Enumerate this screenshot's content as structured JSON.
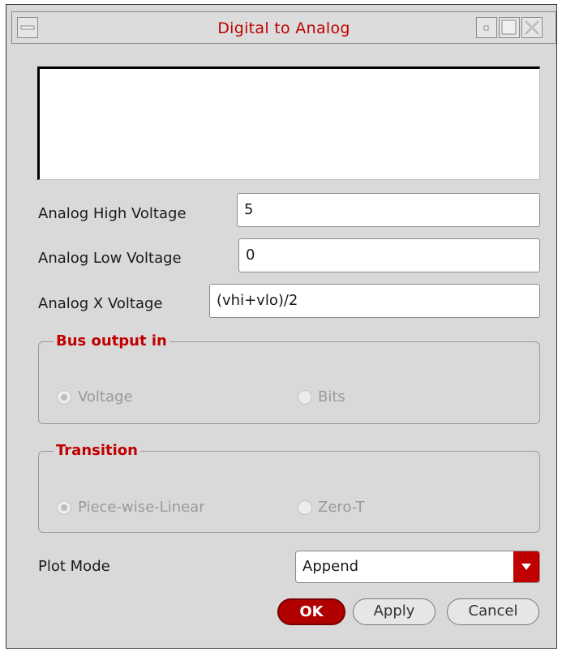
{
  "window": {
    "title": "Digital to Analog"
  },
  "fields": {
    "high": {
      "label": "Analog High Voltage",
      "value": "5"
    },
    "low": {
      "label": "Analog Low Voltage",
      "value": "0"
    },
    "x": {
      "label": "Analog X Voltage",
      "value": "(vhi+vlo)/2"
    }
  },
  "bus_output": {
    "title": "Bus output in",
    "options": [
      {
        "label": "Voltage",
        "selected": true
      },
      {
        "label": "Bits",
        "selected": false
      }
    ]
  },
  "transition": {
    "title": "Transition",
    "options": [
      {
        "label": "Piece-wise-Linear",
        "selected": true
      },
      {
        "label": "Zero-T",
        "selected": false
      }
    ]
  },
  "plot_mode": {
    "label": "Plot Mode",
    "value": "Append"
  },
  "buttons": {
    "ok": "OK",
    "apply": "Apply",
    "cancel": "Cancel"
  },
  "colors": {
    "accent": "#c00000",
    "background": "#d9d9d9"
  }
}
